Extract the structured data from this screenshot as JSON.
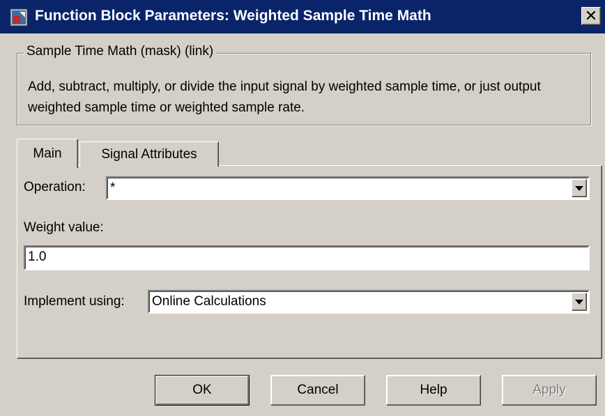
{
  "window": {
    "title": "Function Block Parameters: Weighted Sample Time Math",
    "close_glyph": "✕"
  },
  "group": {
    "legend": "Sample Time Math (mask) (link)",
    "description": "Add, subtract, multiply, or divide the input signal by weighted sample time, or just output weighted sample time or weighted sample rate."
  },
  "tabs": [
    {
      "label": "Main",
      "selected": true
    },
    {
      "label": "Signal Attributes",
      "selected": false
    }
  ],
  "main": {
    "operation_label": "Operation:",
    "operation_value": "*",
    "weight_label": "Weight value:",
    "weight_value": "1.0",
    "implement_label": "Implement using:",
    "implement_value": "Online Calculations"
  },
  "buttons": {
    "ok": "OK",
    "cancel": "Cancel",
    "help": "Help",
    "apply": "Apply"
  },
  "icons": {
    "app": "simulink-block-icon",
    "dropdown": "chevron-down-icon"
  },
  "colors": {
    "titlebar": "#0a246a",
    "face": "#d4d0c8",
    "disabled_text": "#808080"
  }
}
